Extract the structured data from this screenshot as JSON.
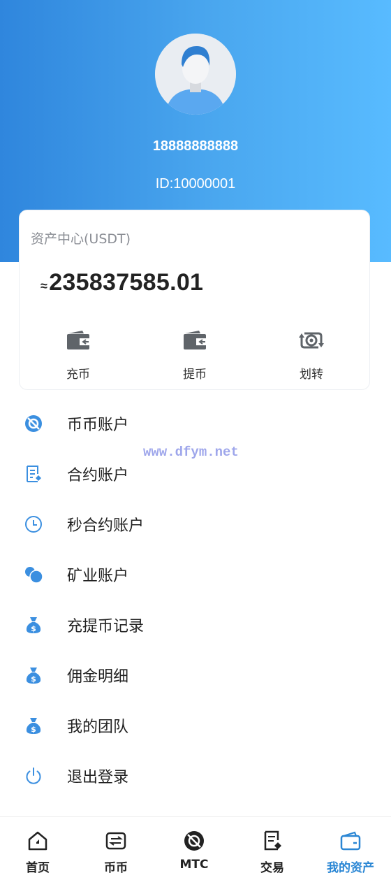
{
  "profile": {
    "phone": "18888888888",
    "id_text": "ID:10000001"
  },
  "asset_card": {
    "title": "资产中心(USDT)",
    "approx_symbol": "≈",
    "balance": "235837585.01",
    "actions": [
      {
        "label": "充币",
        "icon": "wallet-icon"
      },
      {
        "label": "提币",
        "icon": "wallet-icon"
      },
      {
        "label": "划转",
        "icon": "transfer-icon"
      }
    ]
  },
  "menu": {
    "items": [
      {
        "label": "币币账户",
        "icon": "no-coin-icon"
      },
      {
        "label": "合约账户",
        "icon": "contract-icon"
      },
      {
        "label": "秒合约账户",
        "icon": "clock-icon"
      },
      {
        "label": "矿业账户",
        "icon": "circles-icon"
      },
      {
        "label": "充提币记录",
        "icon": "money-bag-icon"
      },
      {
        "label": "佣金明细",
        "icon": "money-bag-icon"
      },
      {
        "label": "我的团队",
        "icon": "money-bag-icon"
      },
      {
        "label": "退出登录",
        "icon": "power-icon"
      }
    ]
  },
  "watermark": "www.dfym.net",
  "tabbar": {
    "tabs": [
      {
        "label": "首页",
        "icon": "home-icon",
        "active": false
      },
      {
        "label": "币币",
        "icon": "exchange-icon",
        "active": false
      },
      {
        "label": "MTC",
        "icon": "mtc-icon",
        "active": false
      },
      {
        "label": "交易",
        "icon": "trade-icon",
        "active": false
      },
      {
        "label": "我的资产",
        "icon": "wallet-icon",
        "active": true
      }
    ]
  },
  "colors": {
    "header_start": "#2f86dd",
    "header_end": "#58bbff",
    "accent": "#2a86d4",
    "menu_icon": "#3b8fe0"
  }
}
